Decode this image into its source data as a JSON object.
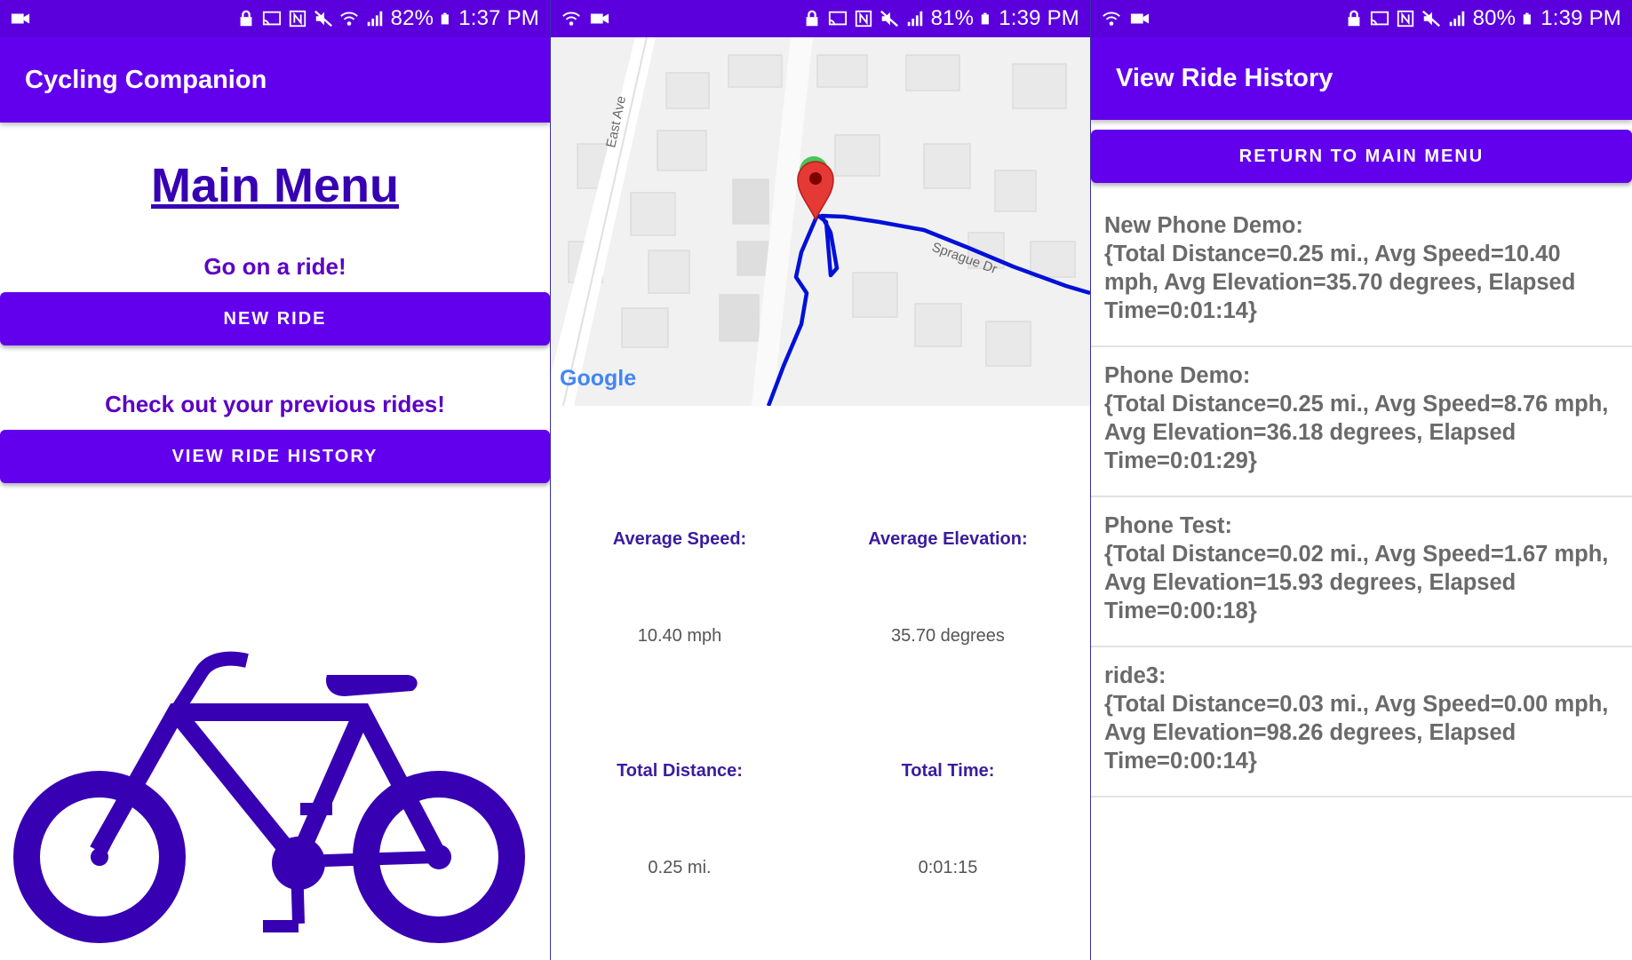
{
  "screens": [
    {
      "status": {
        "battery": "82%",
        "time": "1:37 PM"
      },
      "appbar_title": "Cycling Companion",
      "heading": "Main Menu",
      "ride_prompt": "Go on a ride!",
      "new_ride_label": "NEW RIDE",
      "history_prompt": "Check out your previous rides!",
      "view_history_label": "VIEW RIDE HISTORY"
    },
    {
      "status": {
        "battery": "81%",
        "time": "1:39 PM"
      },
      "map": {
        "streets": [
          "East Ave",
          "Sprague Dr"
        ],
        "logo": "Google"
      },
      "stats": {
        "avg_speed_label": "Average Speed:",
        "avg_speed_value": "10.40 mph",
        "avg_elev_label": "Average Elevation:",
        "avg_elev_value": "35.70 degrees",
        "distance_label": "Total Distance:",
        "distance_value": "0.25 mi.",
        "time_label": "Total Time:",
        "time_value": "0:01:15"
      }
    },
    {
      "status": {
        "battery": "80%",
        "time": "1:39 PM"
      },
      "appbar_title": "View Ride History",
      "return_label": "RETURN TO MAIN MENU",
      "rides": [
        {
          "name": "New Phone Demo:",
          "detail": "{Total Distance=0.25 mi., Avg Speed=10.40 mph, Avg Elevation=35.70 degrees, Elapsed Time=0:01:14}"
        },
        {
          "name": "Phone Demo:",
          "detail": "{Total Distance=0.25 mi., Avg Speed=8.76 mph, Avg Elevation=36.18 degrees, Elapsed Time=0:01:29}"
        },
        {
          "name": "Phone Test:",
          "detail": "{Total Distance=0.02 mi., Avg Speed=1.67 mph, Avg Elevation=15.93 degrees, Elapsed Time=0:00:18}"
        },
        {
          "name": "ride3:",
          "detail": "{Total Distance=0.03 mi., Avg Speed=0.00 mph, Avg Elevation=98.26 degrees, Elapsed Time=0:00:14}"
        }
      ]
    }
  ],
  "icons": [
    "video-icon",
    "wifi-icon",
    "lock-icon",
    "cast-icon",
    "nfc-icon",
    "mute-icon",
    "signal-icon",
    "battery-icon",
    "map-pin-icon",
    "bicycle-icon"
  ],
  "colors": {
    "primary": "#6200ee",
    "status_bar": "#5b00dd",
    "heading": "#3700b3",
    "route": "#0010d8",
    "pin": "#e53935"
  }
}
